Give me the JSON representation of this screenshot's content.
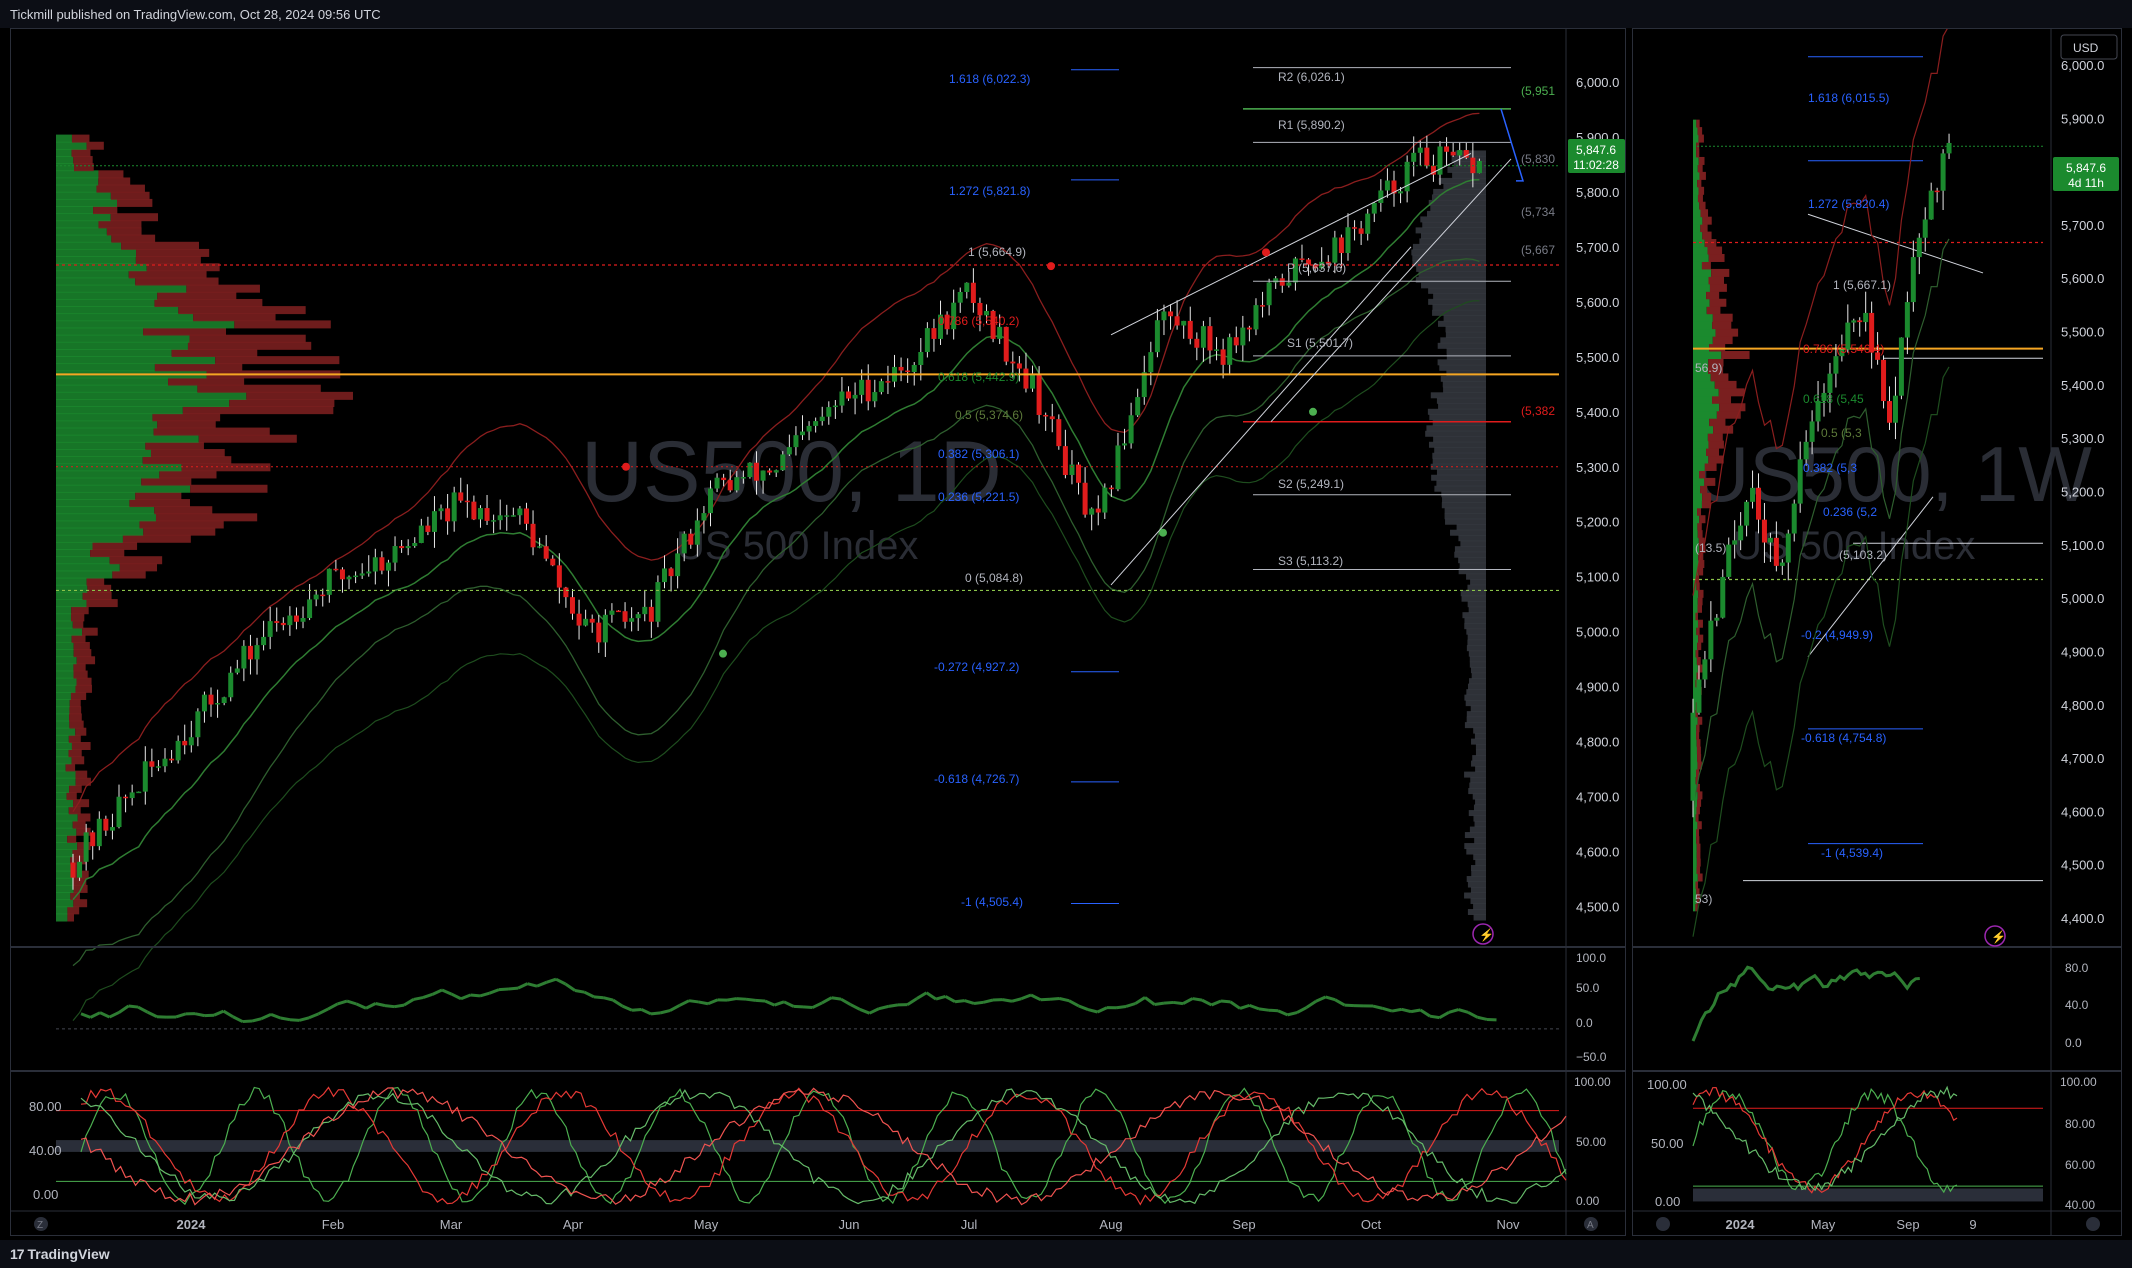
{
  "header": {
    "publisher": "Tickmill published on TradingView.com, Oct 28, 2024 09:56 UTC"
  },
  "footer": {
    "brand": "TradingView",
    "logo_glyph": "17",
    "scale_z": "Z",
    "scale_a": "A"
  },
  "colors": {
    "bull": "#1b8a2e",
    "bear": "#e01c1c",
    "accent_orange": "#f5a623",
    "fib_blue": "#2962ff",
    "bg": "#000000"
  },
  "daily": {
    "watermark_symbol": "US500, 1D",
    "watermark_name": "US 500 Index",
    "last_price": "5,847.6",
    "countdown": "11:02:28",
    "price_ticks": [
      "6,000.0",
      "5,900.0",
      "5,800.0",
      "5,700.0",
      "5,600.0",
      "5,500.0",
      "5,400.0",
      "5,300.0",
      "5,200.0",
      "5,100.0",
      "5,000.0",
      "4,900.0",
      "4,800.0",
      "4,700.0",
      "4,600.0",
      "4,500.0"
    ],
    "time_ticks": [
      "2024",
      "Feb",
      "Mar",
      "Apr",
      "May",
      "Jun",
      "Jul",
      "Aug",
      "Sep",
      "Oct",
      "Nov"
    ],
    "fib_labels": [
      "1.618 (6,022.3)",
      "1.272 (5,821.8)",
      "1 (5,664.9)",
      "0.786 (5,540.2)",
      "0.618 (5,442.9)",
      "0.5 (5,374.6)",
      "0.382 (5,306.1)",
      "0.236 (5,221.5)",
      "0 (5,084.8)",
      "-0.272 (4,927.2)",
      "-0.618 (4,726.7)",
      "-1 (4,505.4)"
    ],
    "pivot_labels": [
      "R2 (6,026.1)",
      "R1 (5,890.2)",
      "P (5,637.6)",
      "S1 (5,501.7)",
      "S2 (5,249.1)",
      "S3 (5,113.2)"
    ],
    "edge_labels": [
      "(5,951",
      "(5,830",
      "(5,734",
      "(5,667",
      "(5,382"
    ],
    "rsi_ticks": [
      "100.0",
      "50.0",
      "0.0",
      "−50.0"
    ],
    "stoch_ticks_left": [
      "80.00",
      "40.00",
      "0.00"
    ],
    "stoch_ticks_right": [
      "100.00",
      "50.00",
      "0.00"
    ]
  },
  "weekly": {
    "watermark_symbol": "US500, 1W",
    "watermark_name": "US 500 Index",
    "currency": "USD",
    "last_price": "5,847.6",
    "countdown": "4d 11h",
    "price_ticks": [
      "6,000.0",
      "5,900.0",
      "5,800.0",
      "5,700.0",
      "5,600.0",
      "5,500.0",
      "5,400.0",
      "5,300.0",
      "5,200.0",
      "5,100.0",
      "5,000.0",
      "4,900.0",
      "4,800.0",
      "4,700.0",
      "4,600.0",
      "4,500.0",
      "4,400.0"
    ],
    "time_ticks": [
      "2024",
      "May",
      "Sep",
      "9"
    ],
    "fib_labels": [
      "1.618 (6,015.5)",
      "1.272 (5,820.4)",
      "1 (5,667.1)",
      "0.786 (5,546.4)",
      "0.618 (5,45",
      "0.5 (5,3",
      "0.382 (5,3",
      "0.236 (5,2",
      "(5,103.2)",
      "-0.2 (4,949.9)",
      "-0.618 (4,754.8)",
      "-1 (4,539.4)"
    ],
    "edge_labels": [
      "56.9)",
      "(13.5)",
      "53)"
    ],
    "rsi_ticks": [
      "80.0",
      "40.0",
      "0.0"
    ],
    "stoch_ticks_left": [
      "100.00",
      "50.00",
      "0.00"
    ],
    "stoch_ticks_right": [
      "100.00",
      "80.00",
      "60.00",
      "40.00"
    ]
  },
  "chart_data": [
    {
      "type": "candlestick",
      "title": "US500, 1D",
      "subtitle": "US 500 Index",
      "ylim": [
        4450,
        6060
      ],
      "x": [
        "2023-12-27",
        "2024-01-10",
        "2024-01-24",
        "2024-02-07",
        "2024-02-21",
        "2024-03-06",
        "2024-03-20",
        "2024-04-03",
        "2024-04-17",
        "2024-05-01",
        "2024-05-15",
        "2024-05-29",
        "2024-06-12",
        "2024-06-26",
        "2024-07-10",
        "2024-07-24",
        "2024-08-05",
        "2024-08-19",
        "2024-09-02",
        "2024-09-16",
        "2024-09-30",
        "2024-10-14",
        "2024-10-25"
      ],
      "close": [
        4580,
        4720,
        4850,
        4995,
        5090,
        5140,
        5230,
        5210,
        5000,
        5030,
        5260,
        5300,
        5420,
        5480,
        5620,
        5450,
        5180,
        5580,
        5510,
        5650,
        5720,
        5860,
        5847.6
      ],
      "last": 5847.6
    },
    {
      "type": "line",
      "title": "US500, 1W",
      "subtitle": "US 500 Index",
      "ylim": [
        4370,
        6030
      ],
      "x": [
        "2024-01",
        "2024-02",
        "2024-03",
        "2024-04",
        "2024-05",
        "2024-06",
        "2024-07",
        "2024-08",
        "2024-09",
        "2024-10"
      ],
      "values": [
        4820,
        5020,
        5220,
        5040,
        5300,
        5460,
        5540,
        5340,
        5720,
        5847.6
      ]
    }
  ]
}
